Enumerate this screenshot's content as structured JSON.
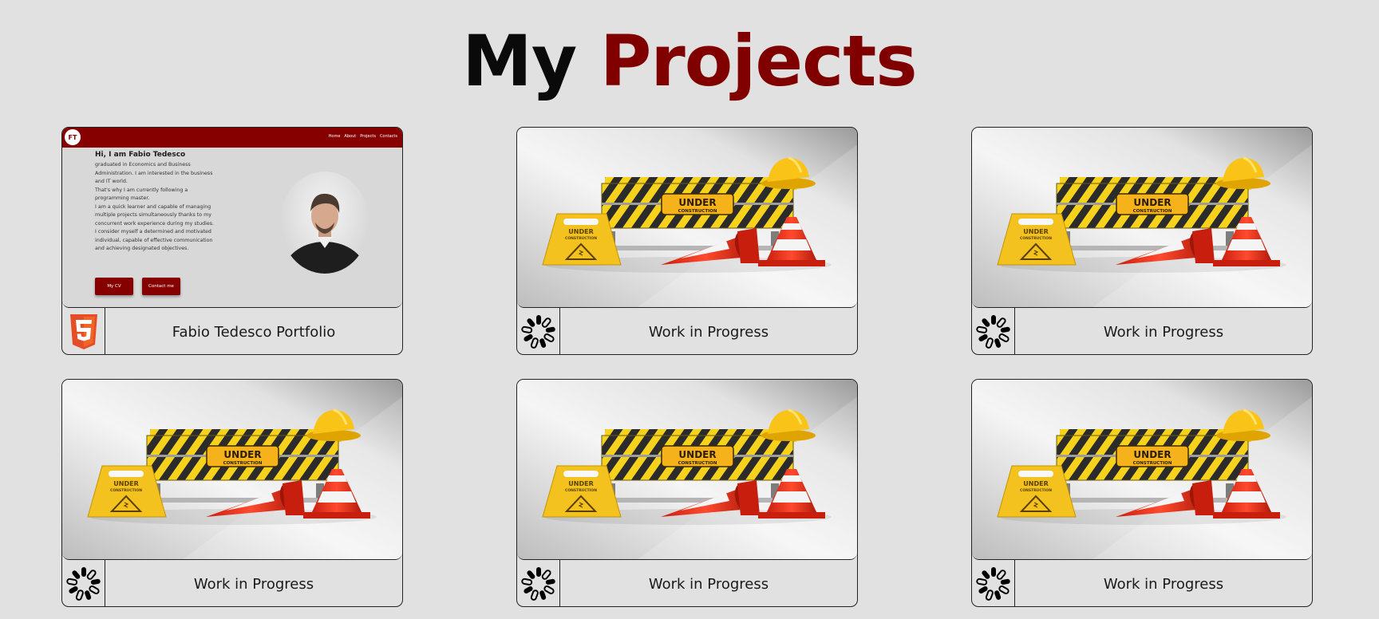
{
  "page": {
    "title_part1": "My",
    "title_part2": "Projects",
    "accent_color": "#800000"
  },
  "portfolio_preview": {
    "logo": "FT",
    "nav_links": [
      "Home",
      "About",
      "Projects",
      "Contacts"
    ],
    "greeting": "Hi, I am Fabio Tedesco",
    "bio_lines": [
      "graduated in Economics and Business",
      "Administration. I am interested in the business",
      "and IT world.",
      "That's why I am currently following a",
      "programming master.",
      "I am a quick learner and capable of managing",
      "multiple projects simultaneously thanks to my",
      "concurrent work experience during my studies.",
      "I consider myself a determined and motivated",
      "individual, capable of effective communication",
      "and achieving designated objectives."
    ],
    "cv_button": "My CV",
    "contact_button": "Contact me"
  },
  "projects": [
    {
      "title": "Fabio Tedesco Portfolio",
      "icon": "html5-icon",
      "preview": "portfolio"
    },
    {
      "title": "Work in Progress",
      "icon": "spinner-icon",
      "preview": "under-construction"
    },
    {
      "title": "Work in Progress",
      "icon": "spinner-icon",
      "preview": "under-construction"
    },
    {
      "title": "Work in Progress",
      "icon": "spinner-icon",
      "preview": "under-construction"
    },
    {
      "title": "Work in Progress",
      "icon": "spinner-icon",
      "preview": "under-construction"
    },
    {
      "title": "Work in Progress",
      "icon": "spinner-icon",
      "preview": "under-construction"
    }
  ],
  "under_construction_sign": {
    "line1": "UNDER",
    "line2": "CONSTRUCTION"
  }
}
